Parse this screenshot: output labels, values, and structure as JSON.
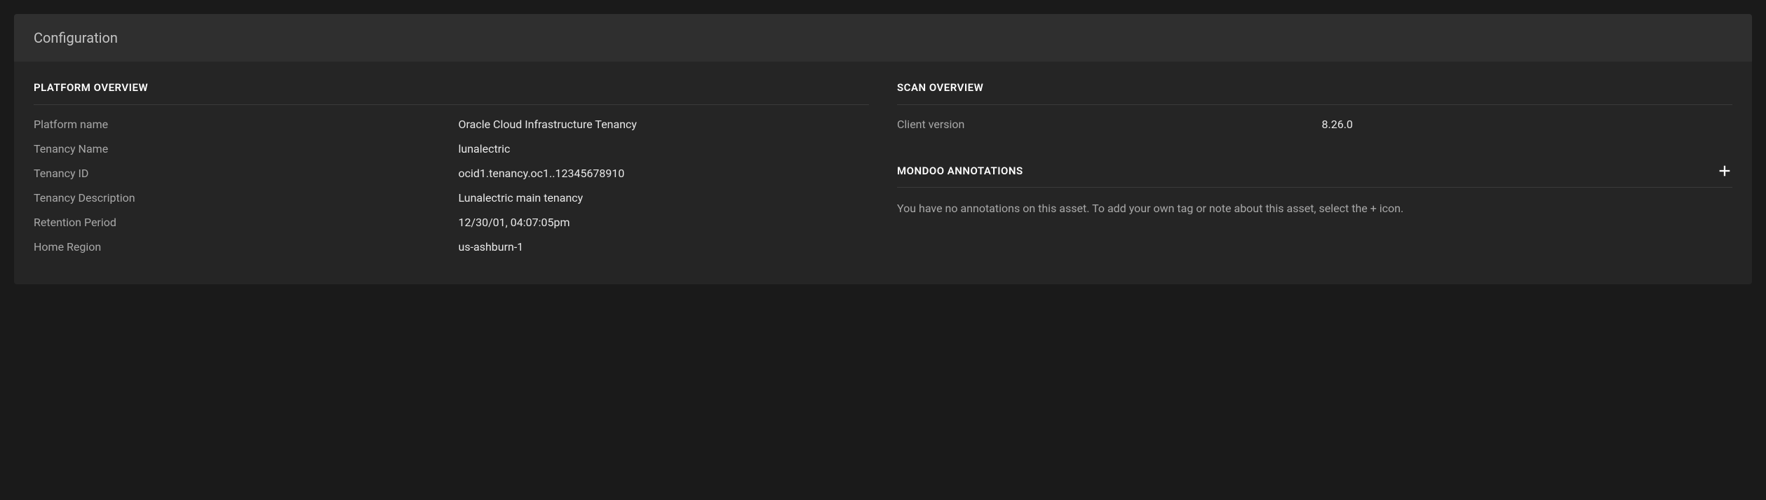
{
  "header": {
    "title": "Configuration"
  },
  "platform_overview": {
    "section_title": "PLATFORM OVERVIEW",
    "rows": [
      {
        "label": "Platform name",
        "value": "Oracle Cloud Infrastructure Tenancy"
      },
      {
        "label": "Tenancy Name",
        "value": "lunalectric"
      },
      {
        "label": "Tenancy ID",
        "value": "ocid1.tenancy.oc1..12345678910"
      },
      {
        "label": "Tenancy Description",
        "value": "Lunalectric main tenancy"
      },
      {
        "label": "Retention Period",
        "value": "12/30/01, 04:07:05pm"
      },
      {
        "label": "Home Region",
        "value": "us-ashburn-1"
      }
    ]
  },
  "scan_overview": {
    "section_title": "SCAN OVERVIEW",
    "rows": [
      {
        "label": "Client version",
        "value": "8.26.0"
      }
    ]
  },
  "annotations": {
    "section_title": "MONDOO ANNOTATIONS",
    "empty_text": "You have no annotations on this asset. To add your own tag or note about this asset, select the + icon."
  }
}
